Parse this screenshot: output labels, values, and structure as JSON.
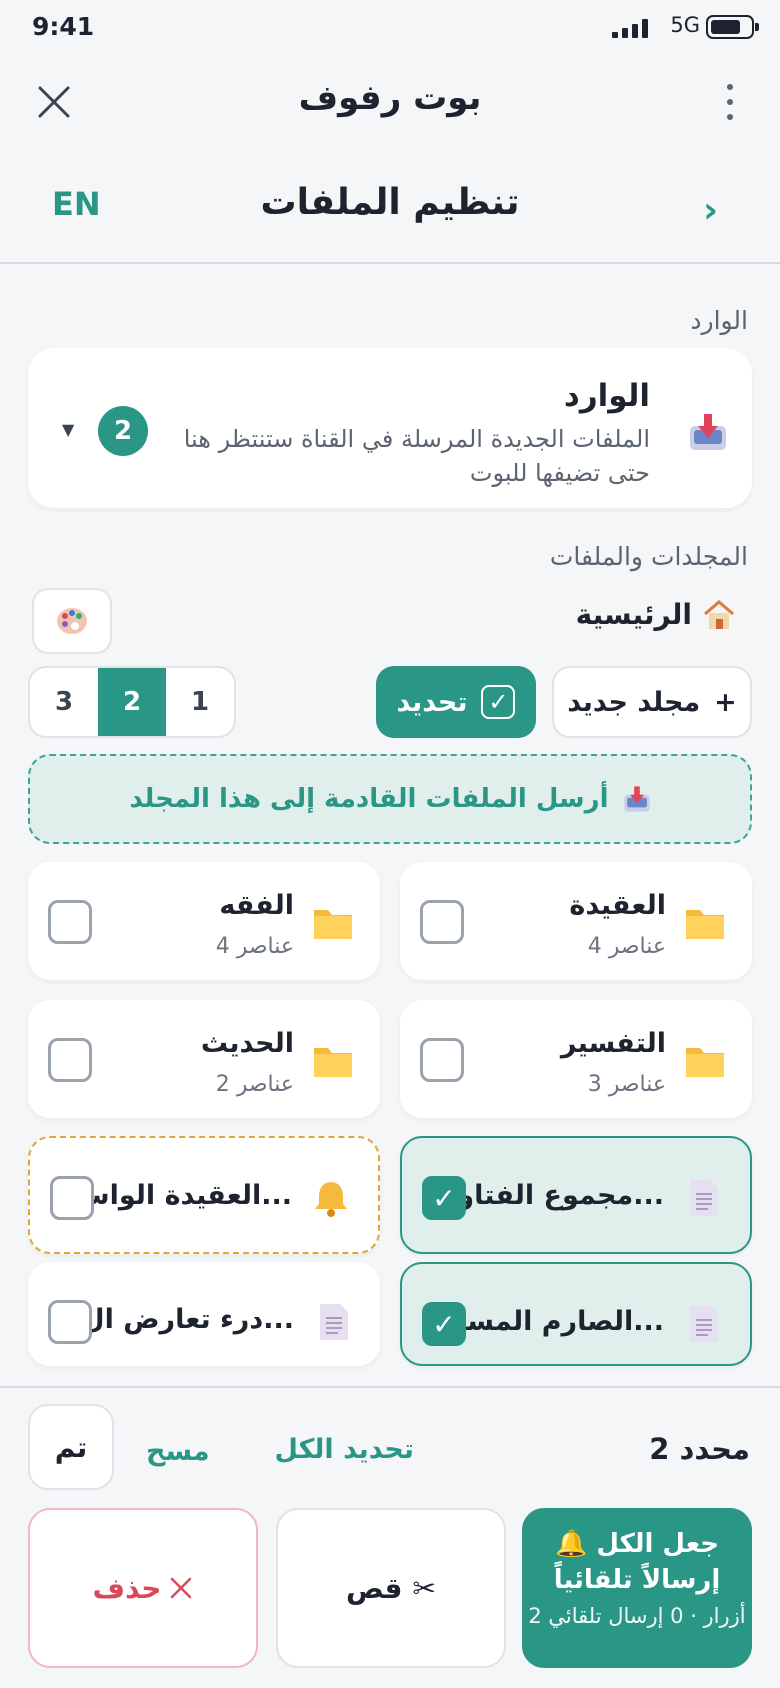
{
  "status": {
    "time": "9:41",
    "network": "5G"
  },
  "topbar": {
    "title": "بوت رفوف"
  },
  "header": {
    "title": "تنظيم الملفات",
    "lang": "EN"
  },
  "inbox": {
    "section_label": "الوارد",
    "title": "الوارد",
    "description": "الملفات الجديدة المرسلة في القناة ستنتظر هنا حتى تضيفها للبوت",
    "count": "2"
  },
  "folders": {
    "section_label": "المجلدات والملفات",
    "home_label": "الرئيسية",
    "new_folder_label": "مجلد جديد",
    "select_label": "تحديد",
    "pages": [
      "1",
      "2",
      "3"
    ],
    "active_page": "2",
    "send_here_label": "أرسل الملفات القادمة إلى هذا المجلد"
  },
  "items": [
    {
      "name": "العقيدة",
      "count": "4 عناصر",
      "icon": "folder-icon",
      "checked": false
    },
    {
      "name": "الفقه",
      "count": "4 عناصر",
      "icon": "folder-icon",
      "checked": false
    },
    {
      "name": "التفسير",
      "count": "3 عناصر",
      "icon": "folder-icon",
      "checked": false
    },
    {
      "name": "الحديث",
      "count": "2 عناصر",
      "icon": "folder-icon",
      "checked": false
    },
    {
      "name": "مجموع الفتاو...",
      "icon": "file-icon",
      "checked": true
    },
    {
      "name": "العقيدة الواس...",
      "icon": "bell-icon",
      "checked": false
    },
    {
      "name": "الصارم المسل...",
      "icon": "file-icon",
      "checked": true
    },
    {
      "name": "درء تعارض ال...",
      "icon": "file-icon",
      "checked": false
    }
  ],
  "bottom": {
    "selected_count": "2 محدد",
    "select_all": "تحديد الكل",
    "clear": "مسح",
    "done": "تم",
    "auto_all_line1": "جعل الكل",
    "auto_all_line2": "إرسالاً تلقائياً",
    "auto_all_sub": "2 أزرار · 0 إرسال تلقائي",
    "cut": "قص",
    "delete": "حذف"
  },
  "colors": {
    "accent": "#2a9686",
    "danger": "#d9485a",
    "auto_border": "#e0a63a"
  }
}
